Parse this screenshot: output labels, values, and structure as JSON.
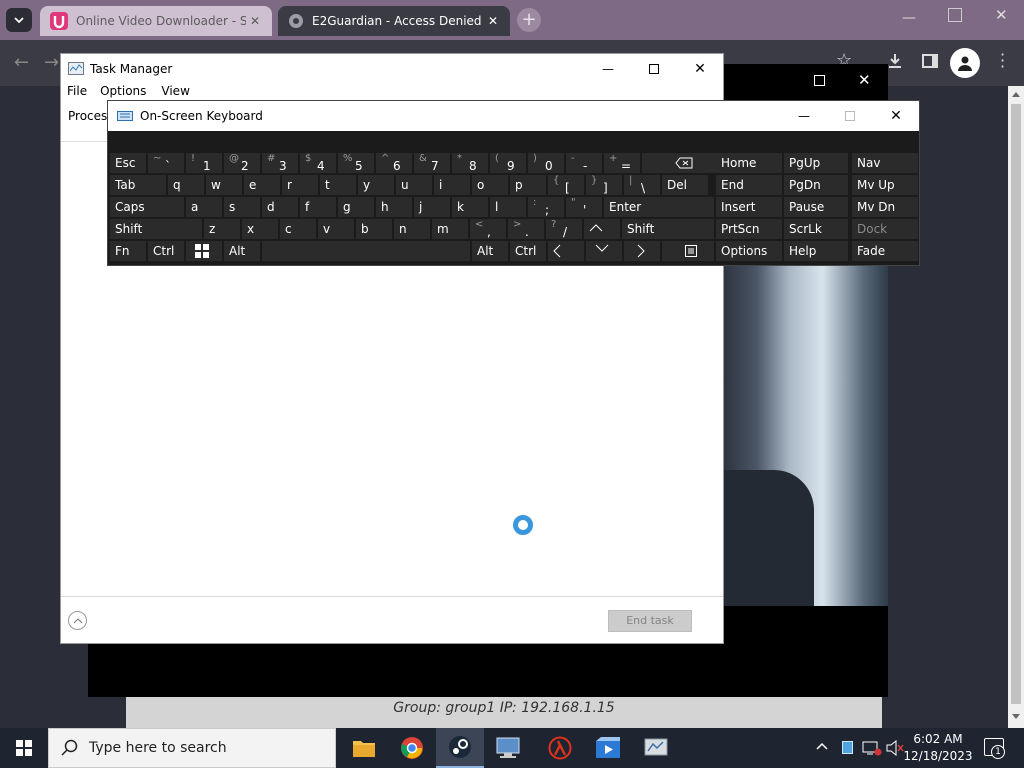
{
  "browser": {
    "tabs": [
      {
        "title": "Online Video Downloader - SSV",
        "icon": "ssyoutube-logo-icon"
      },
      {
        "title": "E2Guardian - Access Denied",
        "icon": "globe-icon"
      }
    ],
    "footer_text": "Group: group1   IP: 192.168.1.15"
  },
  "task_manager": {
    "title": "Task Manager",
    "menu": [
      "File",
      "Options",
      "View"
    ],
    "tab_label": "Process",
    "end_task_label": "End task"
  },
  "osk": {
    "title": "On-Screen Keyboard",
    "rows": [
      [
        {
          "shift": "~",
          "main": "`"
        },
        {
          "shift": "!",
          "main": "1"
        },
        {
          "shift": "@",
          "main": "2"
        },
        {
          "shift": "#",
          "main": "3"
        },
        {
          "shift": "$",
          "main": "4"
        },
        {
          "shift": "%",
          "main": "5"
        },
        {
          "shift": "^",
          "main": "6"
        },
        {
          "shift": "&",
          "main": "7"
        },
        {
          "shift": "*",
          "main": "8"
        },
        {
          "shift": "(",
          "main": "9"
        },
        {
          "shift": ")",
          "main": "0"
        },
        {
          "shift": "-",
          "main": "-"
        },
        {
          "shift": "+",
          "main": "="
        }
      ],
      [
        {
          "main": "q"
        },
        {
          "main": "w"
        },
        {
          "main": "e"
        },
        {
          "main": "r"
        },
        {
          "main": "t"
        },
        {
          "main": "y"
        },
        {
          "main": "u"
        },
        {
          "main": "i"
        },
        {
          "main": "o"
        },
        {
          "main": "p"
        },
        {
          "shift": "{",
          "main": "["
        },
        {
          "shift": "}",
          "main": "]"
        },
        {
          "shift": "|",
          "main": "\\"
        }
      ],
      [
        {
          "main": "a"
        },
        {
          "main": "s"
        },
        {
          "main": "d"
        },
        {
          "main": "f"
        },
        {
          "main": "g"
        },
        {
          "main": "h"
        },
        {
          "main": "j"
        },
        {
          "main": "k"
        },
        {
          "main": "l"
        },
        {
          "shift": ":",
          "main": ";"
        },
        {
          "shift": "\"",
          "main": "'"
        }
      ],
      [
        {
          "main": "z"
        },
        {
          "main": "x"
        },
        {
          "main": "c"
        },
        {
          "main": "v"
        },
        {
          "main": "b"
        },
        {
          "main": "n"
        },
        {
          "main": "m"
        },
        {
          "shift": "<",
          "main": ","
        },
        {
          "shift": ">",
          "main": "."
        },
        {
          "shift": "?",
          "main": "/"
        }
      ]
    ],
    "keys": {
      "esc": "Esc",
      "tab": "Tab",
      "caps": "Caps",
      "shift": "Shift",
      "fn": "Fn",
      "ctrl": "Ctrl",
      "alt": "Alt",
      "del": "Del",
      "enter": "Enter",
      "home": "Home",
      "pgup": "PgUp",
      "nav": "Nav",
      "end": "End",
      "pgdn": "PgDn",
      "mvup": "Mv Up",
      "insert": "Insert",
      "pause": "Pause",
      "mvdn": "Mv Dn",
      "prtscn": "PrtScn",
      "scrlk": "ScrLk",
      "dock": "Dock",
      "options": "Options",
      "help": "Help",
      "fade": "Fade"
    }
  },
  "taskbar": {
    "search_placeholder": "Type here to search",
    "pinned": [
      "file-explorer-icon",
      "chrome-icon",
      "steam-icon",
      "remote-desktop-icon",
      "half-life-icon",
      "media-player-icon",
      "network-tool-icon"
    ],
    "time": "6:02 AM",
    "date": "12/18/2023",
    "notification_count": "1"
  },
  "colors": {
    "tabstrip": "#7e6a84",
    "accent": "#3a96dd",
    "taskbar": "#1f2530"
  }
}
